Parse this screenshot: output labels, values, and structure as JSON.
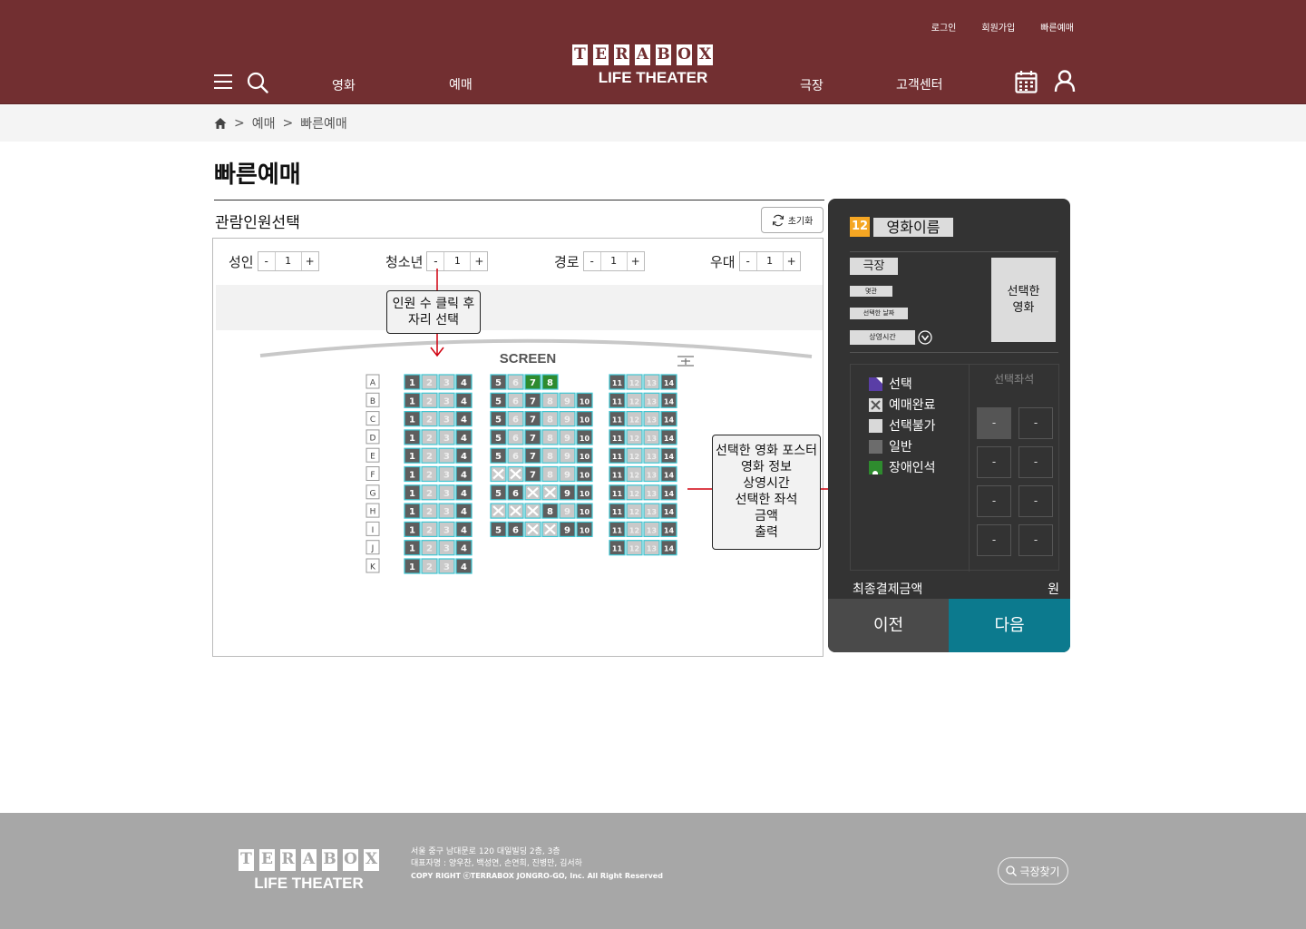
{
  "header": {
    "top_links": [
      "로그인",
      "회원가입",
      "빠른예매"
    ],
    "logo_letters": [
      "T",
      "E",
      "R",
      "A",
      "B",
      "O",
      "X"
    ],
    "logo_sub": "LIFE THEATER",
    "nav": [
      "영화",
      "예매",
      "극장",
      "고객센터"
    ]
  },
  "breadcrumb": {
    "sep": ">",
    "items": [
      "예매",
      "빠른예매"
    ]
  },
  "page_title": "빠른예매",
  "audience": {
    "title": "관람인원선택",
    "reset_label": "초기화",
    "counters": [
      {
        "label": "성인",
        "value": "1"
      },
      {
        "label": "청소년",
        "value": "1"
      },
      {
        "label": "경로",
        "value": "1"
      },
      {
        "label": "우대",
        "value": "1"
      }
    ],
    "minus": "-",
    "plus": "+"
  },
  "notes": {
    "count_then_seat": "인원 수 클릭 후\n자리 선택",
    "output": "선택한 영화 포스터\n영화 정보\n상영시간\n선택한 좌석\n금액\n출력"
  },
  "seatmap": {
    "screen_label": "SCREEN",
    "rows": [
      "A",
      "B",
      "C",
      "D",
      "E",
      "F",
      "G",
      "H",
      "I",
      "J",
      "K"
    ]
  },
  "summary": {
    "age": "12",
    "movie_name": "영화이름",
    "theater": "극장",
    "hall": "몇관",
    "date": "선택한 날짜",
    "time": "상영시간",
    "poster": "선택한\n영화",
    "legend": [
      {
        "label": "선택",
        "color": "#5a3ea6"
      },
      {
        "label": "예매완료",
        "color": "#dddddd"
      },
      {
        "label": "선택불가",
        "color": "#d9d9d9"
      },
      {
        "label": "일반",
        "color": "#6c6c6c"
      },
      {
        "label": "장애인석",
        "color": "#2e8b2e"
      }
    ],
    "seat_title": "선택좌석",
    "slots": [
      "-",
      "-",
      "-",
      "-",
      "-",
      "-",
      "-",
      "-"
    ],
    "total_label": "최종결제금액",
    "total_unit": "원",
    "prev": "이전",
    "next": "다음"
  },
  "footer": {
    "address": "서울 중구 남대문로 120 대일빌딩 2층, 3층",
    "reps": "대표자명 : 양우찬, 백성연, 손연희, 진병만, 김서하",
    "copyright": "COPY RIGHT ⓒTERRABOX JONGRO-GO, Inc. All Right Reserved",
    "find_theater": "극장찾기"
  },
  "colors": {
    "header": "#722f31",
    "accent": "#0c7a8e",
    "panel": "#333333",
    "footer": "#a7a7a7"
  }
}
